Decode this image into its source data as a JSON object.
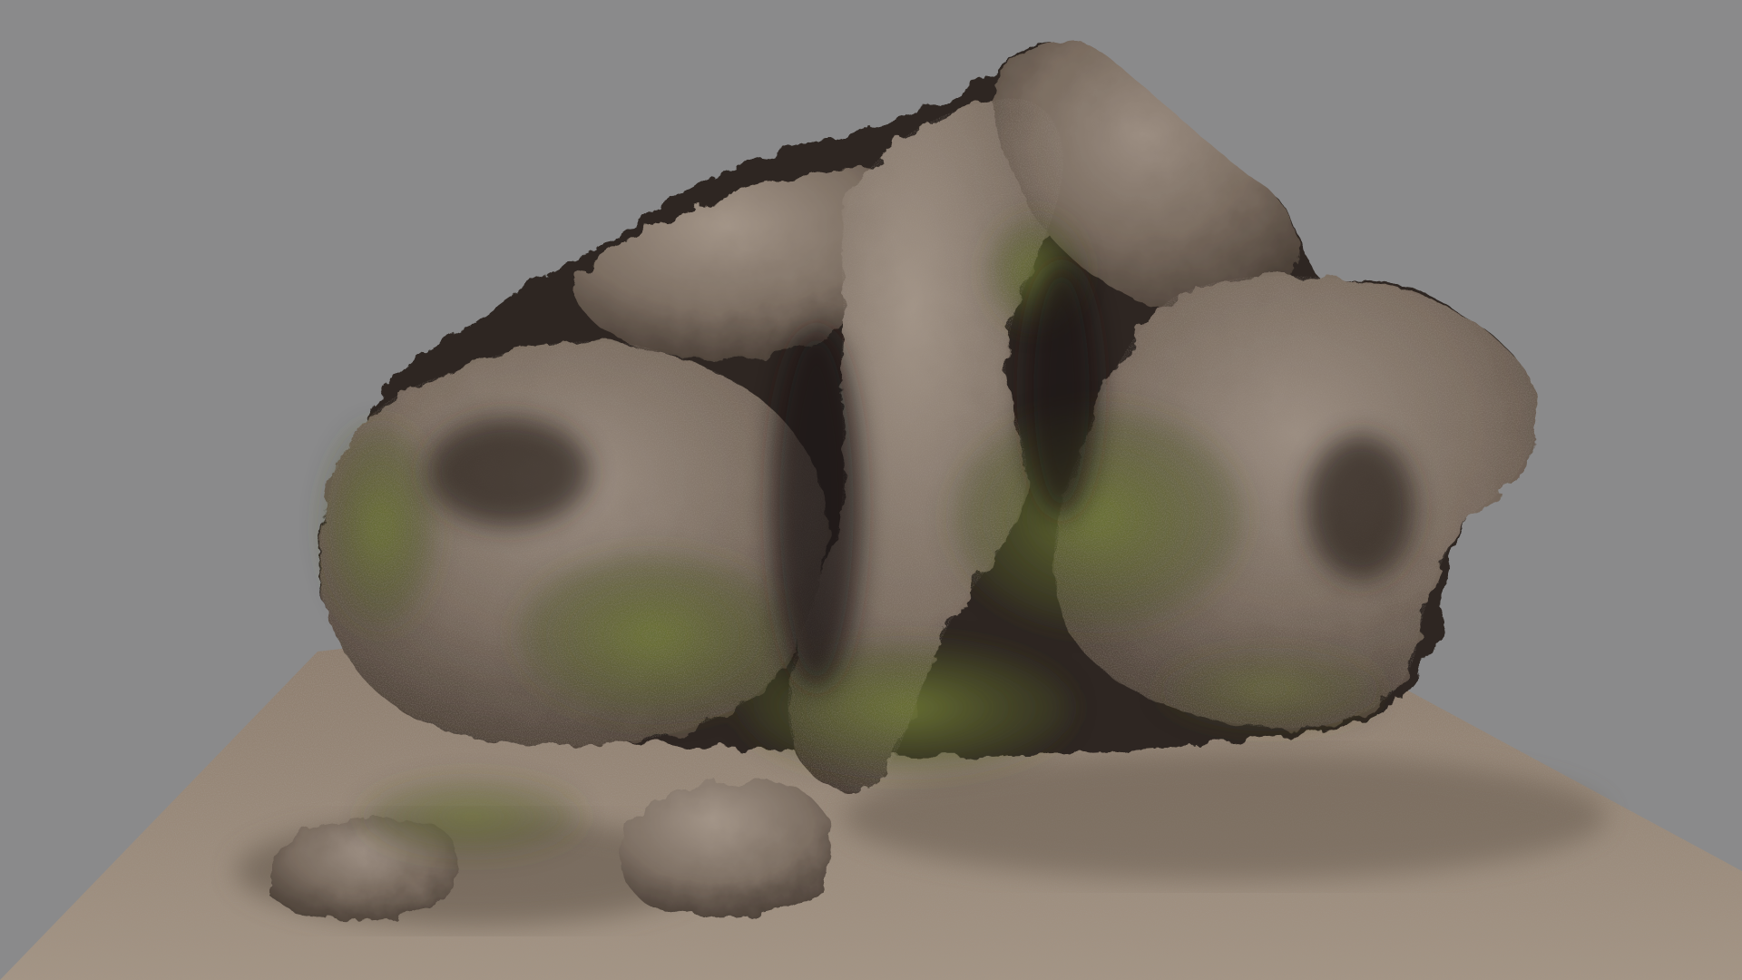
{
  "viewport": {
    "background_color": "#8a8a8b",
    "description_icon": "3d-render-viewport"
  },
  "scene": {
    "subject": "mossy-rock-formation",
    "colors": {
      "ground_light": "#a49585",
      "ground_mid": "#8c7c6d",
      "ground_dark": "#5f5246",
      "rock_light": "#9c8e82",
      "rock_mid": "#7a6c60",
      "rock_dark": "#4a3f36",
      "rock_shadow": "#2f2822",
      "moss_light": "#6d7636",
      "moss_dark": "#3f4520"
    }
  }
}
